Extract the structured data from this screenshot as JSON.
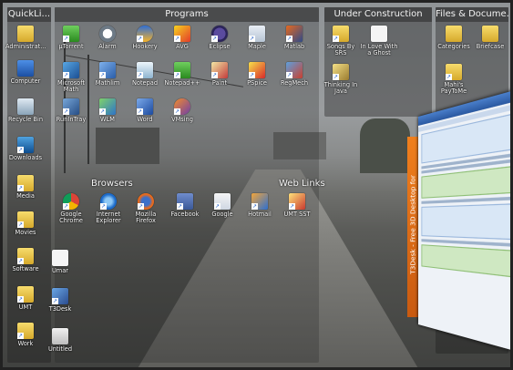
{
  "panels": {
    "quicklinks": {
      "title": "QuickLi..."
    },
    "programs": {
      "title": "Programs"
    },
    "under_construction": {
      "title": "Under Construction"
    },
    "files": {
      "title": "Files & Docume..."
    }
  },
  "groups": {
    "browsers": "Browsers",
    "web_links": "Web Links"
  },
  "quicklinks_icons": [
    "Administrat...",
    "Computer",
    "Recycle Bin",
    "Downloads",
    "Media",
    "Movies",
    "Software",
    "UMT",
    "Work"
  ],
  "programs_icons": [
    [
      "µTorrent",
      "Alarm",
      "Hookery",
      "AVG",
      "Eclipse",
      "Maple",
      "Matlab"
    ],
    [
      "Microsoft Math",
      "Mathlim",
      "Notepad",
      "Notepad++",
      "Paint",
      "PSpice",
      "RegMech"
    ],
    [
      "RunInTray",
      "WLM",
      "Word",
      "VMsing"
    ]
  ],
  "browsers_icons": [
    "Google Chrome",
    "Internet Explorer",
    "Mozilla Firefox"
  ],
  "weblinks_icons": [
    "Facebook",
    "Google",
    "Hotmail",
    "UMT SST"
  ],
  "loose_icons": [
    "Umar",
    "T3Desk",
    "Untitled"
  ],
  "under_construction_icons": [
    "Songs By SRS",
    "In Love With a Ghost",
    "Thinking In Java"
  ],
  "files_icons": [
    "Categories",
    "Briefcase",
    "Mahi's PayToMe"
  ],
  "tdesk_banner": "T3Desk - Free 3D Desktop for",
  "shortcut_glyph": "↗"
}
